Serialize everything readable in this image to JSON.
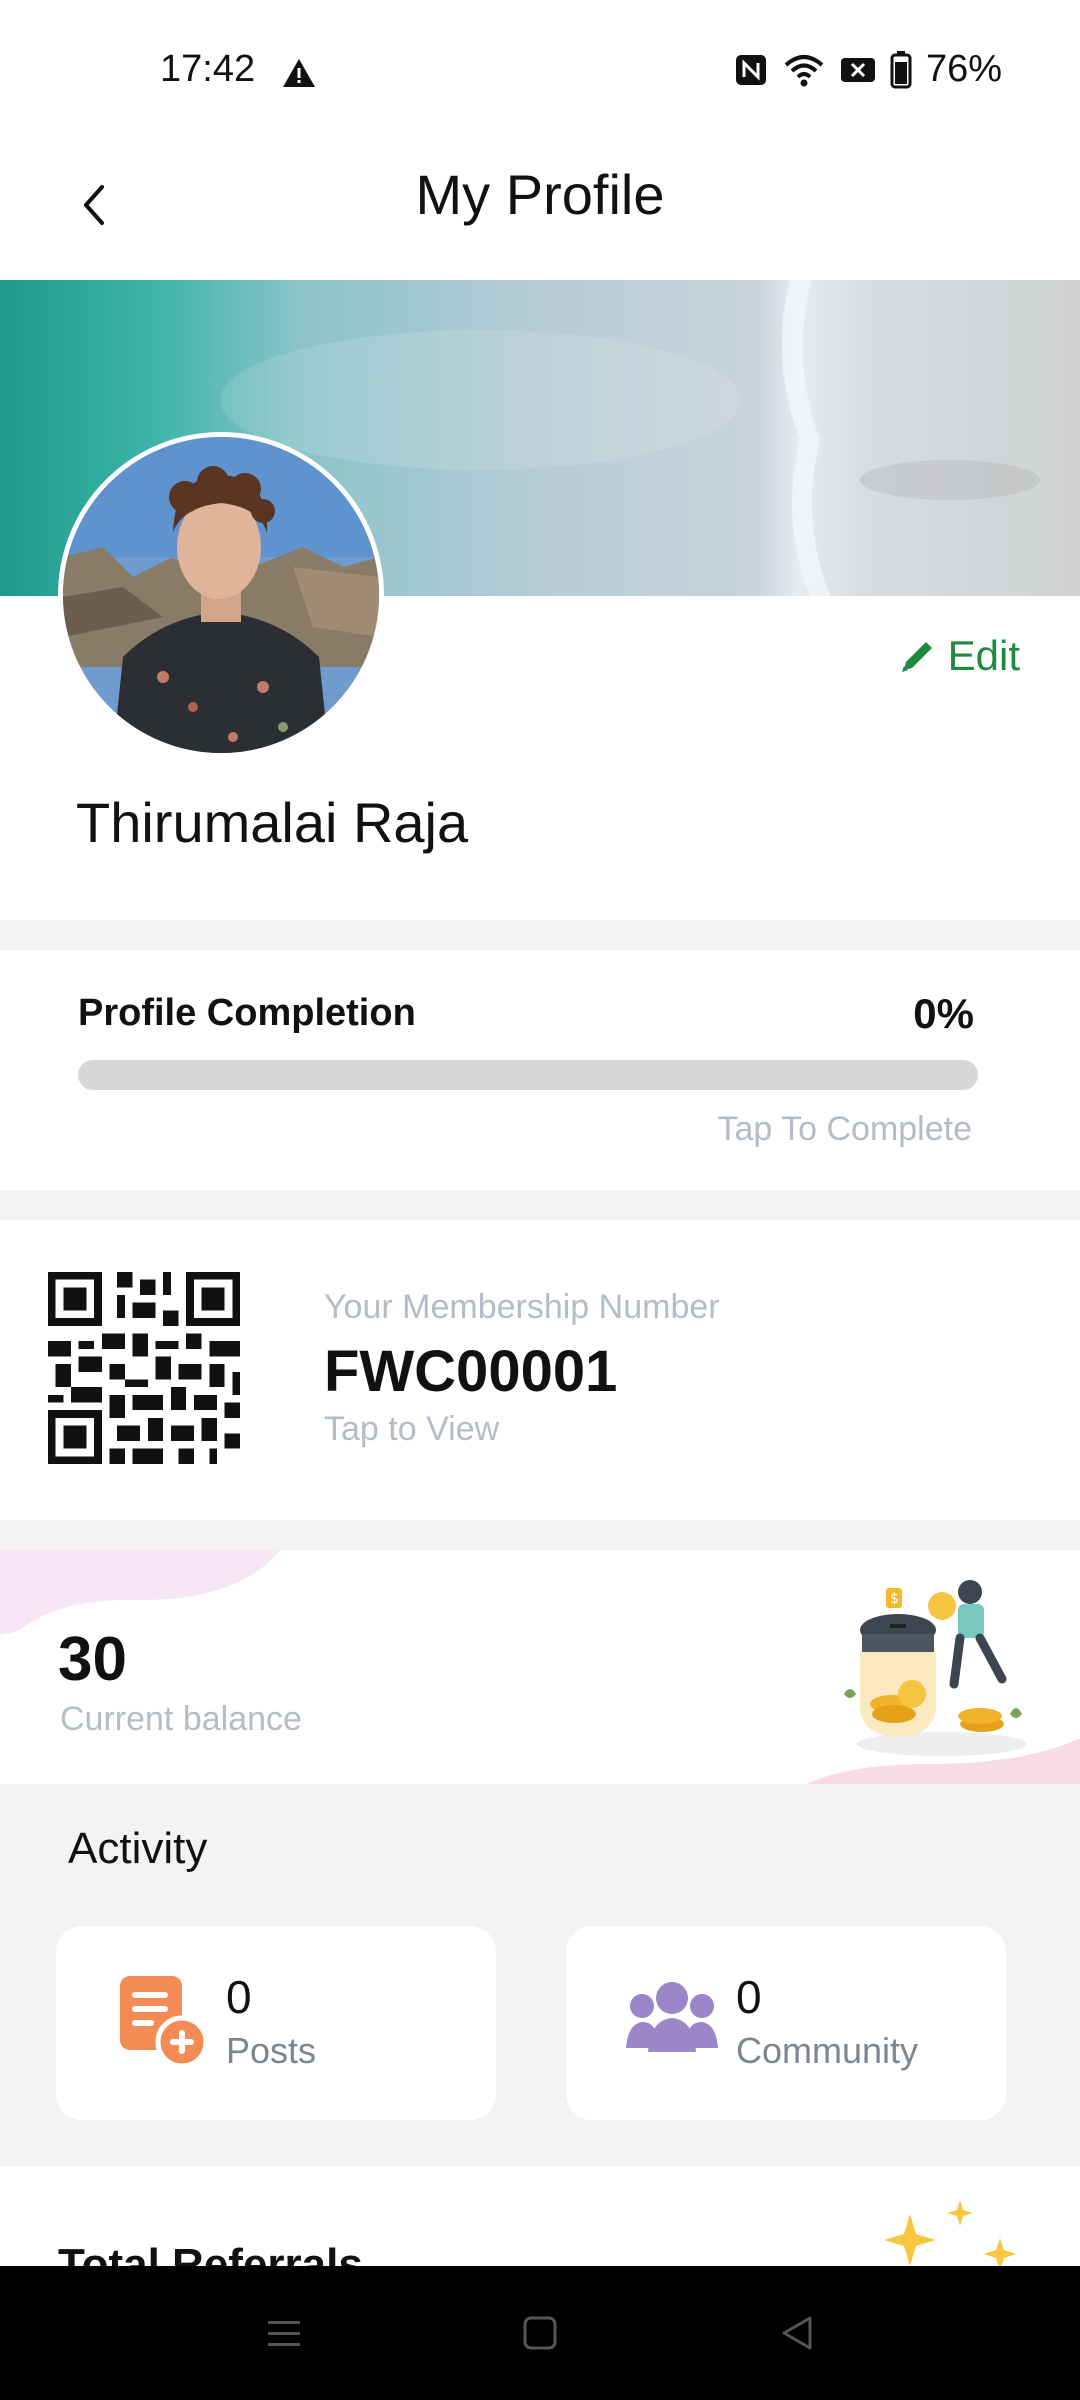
{
  "status_bar": {
    "time": "17:42",
    "battery_percent": "76%",
    "icons": [
      "warning-icon",
      "nfc-icon",
      "wifi-icon",
      "no-sim-icon",
      "battery-icon"
    ]
  },
  "header": {
    "title": "My Profile",
    "back_icon": "chevron-left-icon"
  },
  "profile": {
    "name": "Thirumalai Raja",
    "edit_label": "Edit",
    "edit_icon": "pencil-icon"
  },
  "completion": {
    "label": "Profile Completion",
    "percent_text": "0%",
    "progress_fraction": 0,
    "action": "Tap To Complete"
  },
  "membership": {
    "label": "Your Membership Number",
    "number": "FWC00001",
    "action": "Tap to View"
  },
  "balance": {
    "value": "30",
    "label": "Current balance"
  },
  "activity": {
    "title": "Activity",
    "tiles": [
      {
        "count": "0",
        "label": "Posts",
        "icon": "add-post-icon",
        "color": "#f28b54"
      },
      {
        "count": "0",
        "label": "Community",
        "icon": "community-icon",
        "color": "#9a86c8"
      }
    ]
  },
  "referrals": {
    "title": "Total Referrals"
  },
  "nav": {
    "icons": [
      "menu-icon",
      "home-icon",
      "back-icon"
    ]
  },
  "colors": {
    "accent": "#1f8a3f",
    "muted_text": "#b4bcc6"
  }
}
